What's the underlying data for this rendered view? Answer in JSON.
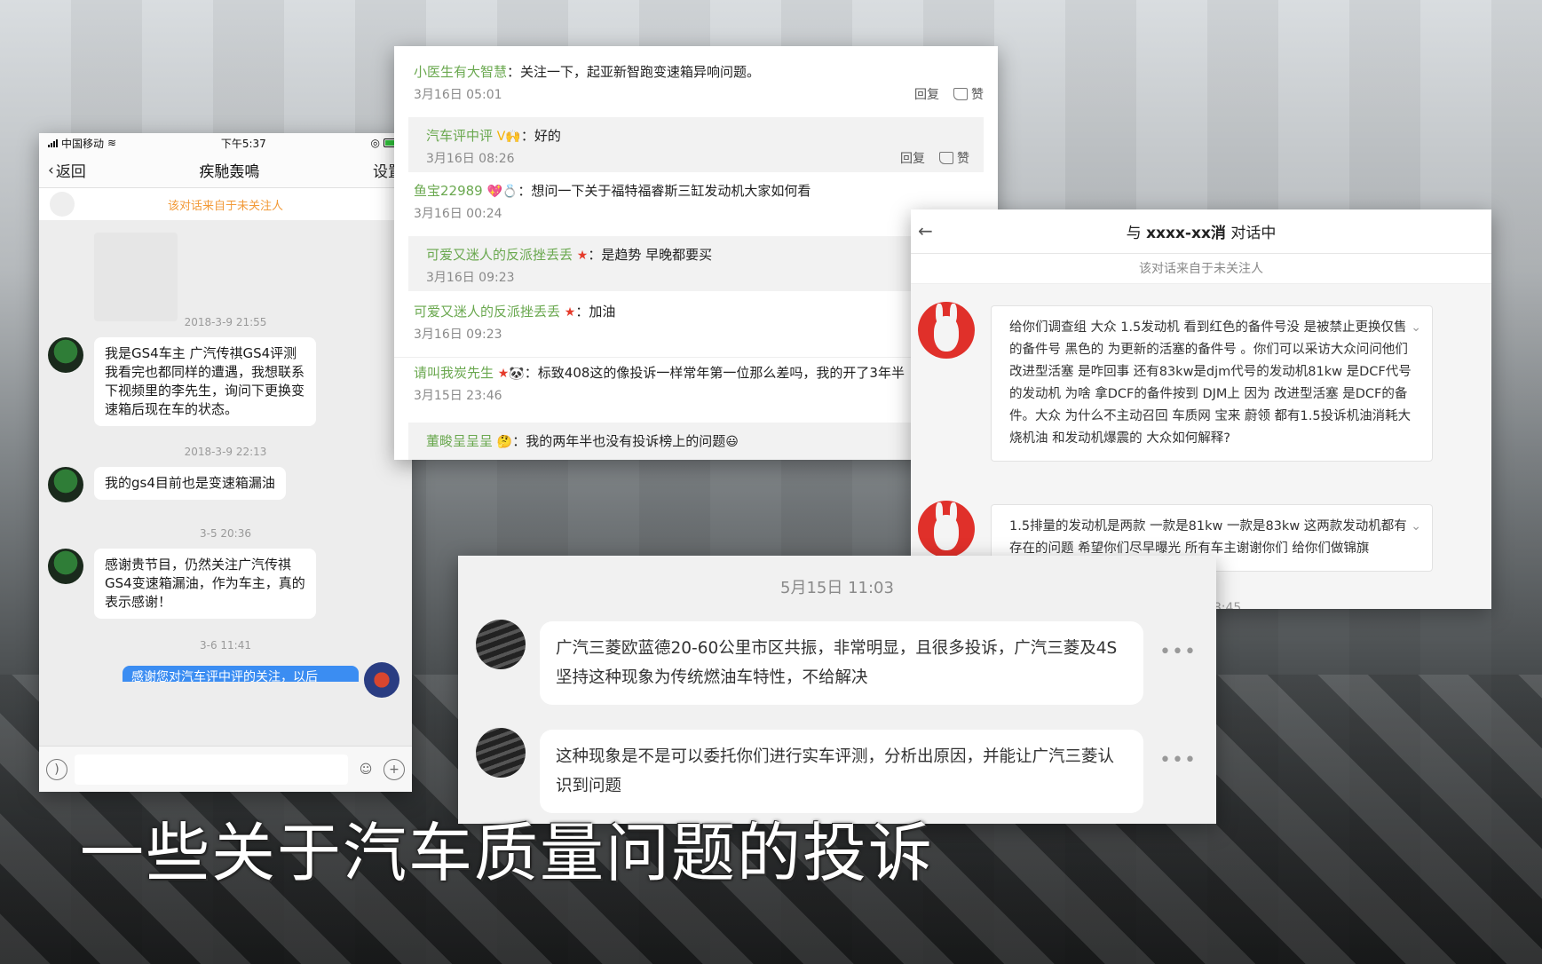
{
  "phone": {
    "status": {
      "carrier": "中国移动",
      "time": "下午5:37"
    },
    "nav": {
      "back": "返回",
      "title": "疾馳轰鳴",
      "settings": "设置"
    },
    "notice": "该对话来自于未关注人",
    "messages": [
      {
        "time": "2018-3-9 21:55",
        "text": "我是GS4车主 广汽传祺GS4评测我看完也都同样的遭遇，我想联系下视频里的李先生，询问下更换变速箱后现在车的状态。"
      },
      {
        "time": "2018-3-9 22:13",
        "text": "我的gs4目前也是变速箱漏油"
      },
      {
        "time": "3-5 20:36",
        "text": "感谢贵节目，仍然关注广汽传祺GS4变速箱漏油，作为车主，真的表示感谢！"
      },
      {
        "time": "3-6 11:41",
        "text": "感谢您对汽车评中评的关注，以后"
      }
    ]
  },
  "comments": {
    "reply_label": "回复",
    "like_label": "赞",
    "items": [
      {
        "name": "小医生有大智慧",
        "text": "：关注一下，起亚新智跑变速箱异响问题。",
        "time": "3月16日 05:01"
      },
      {
        "name": "汽车评中评",
        "badge": "V",
        "text": "：好的",
        "time": "3月16日 08:26"
      },
      {
        "name": "鱼宝22989",
        "text": "：想问一下关于福特福睿斯三缸发动机大家如何看",
        "time": "3月16日 00:24"
      },
      {
        "name": "可爱又迷人的反派挫丢丢",
        "text": "：是趋势 早晚都要买",
        "time": "3月16日 09:23"
      },
      {
        "name": "可爱又迷人的反派挫丢丢",
        "text": "：加油",
        "time": "3月16日 09:23"
      },
      {
        "name": "请叫我炭先生",
        "text": "：标致408这的像投诉一样常年第一位那么差吗，我的开了3年半",
        "time": "3月15日 23:46"
      },
      {
        "name": "董畯呈呈呈",
        "text": "：我的两年半也没有投诉榜上的问题"
      }
    ]
  },
  "dialog": {
    "title_prefix": "与",
    "title_name": "xxxx-xx消",
    "title_suffix": "对话中",
    "notice": "该对话来自于未关注人",
    "messages": [
      "给你们调查组 大众 1.5发动机 看到红色的备件号没 是被禁止更换仅售的备件号 黑色的 为更新的活塞的备件号 。你们可以采访大众问问他们 改进型活塞 是咋回事 还有83kw是djm代号的发动机81kw 是DCF代号的发动机 为啥 拿DCF的备件按到 DJM上 因为 改进型活塞 是DCF的备件。大众 为什么不主动召回 车质网 宝来 蔚领 都有1.5投诉机油消耗大烧机油 和发动机爆震的 大众如何解释?",
      "1.5排量的发动机是两款 一款是81kw 一款是83kw 这两款发动机都有存在的问题 希望你们尽早曝光 所有车主谢谢你们 给你们做锦旗"
    ],
    "footer_time": "3月7日 08:45"
  },
  "messages_panel": {
    "date": "5月15日 11:03",
    "messages": [
      "广汽三菱欧蓝德20-60公里市区共振，非常明显，且很多投诉，广汽三菱及4S坚持这种现象为传统燃油车特性，不给解决",
      "这种现象是不是可以委托你们进行实车评测，分析出原因，并能让广汽三菱认识到问题"
    ]
  },
  "caption": "一些关于汽车质量问题的投诉"
}
